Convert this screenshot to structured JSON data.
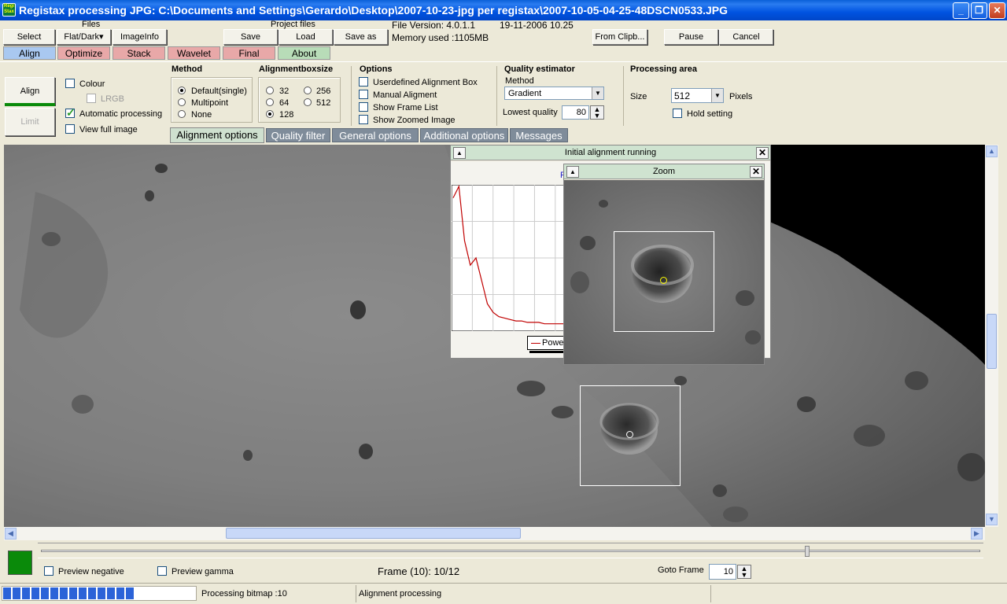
{
  "window": {
    "title": "Registax processing JPG: C:\\Documents and Settings\\Gerardo\\Desktop\\2007-10-23-jpg per registax\\2007-10-05-04-25-48DSCN0533.JPG",
    "icon_text": "Regi Stax",
    "min": "_",
    "max": "❐",
    "close": "✕"
  },
  "toolbar": {
    "files_label": "Files",
    "select": "Select",
    "flatdark": "Flat/Dark",
    "flatdark_arrow": "▾",
    "imageinfo": "ImageInfo",
    "project_label": "Project files",
    "save": "Save",
    "load": "Load",
    "saveas": "Save as",
    "file_version": "File Version: 4.0.1.1",
    "date": "19-11-2006 10.25",
    "memory": "Memory used :1105MB",
    "from_clip": "From Clipb...",
    "pause": "Pause",
    "cancel": "Cancel"
  },
  "tabs": [
    {
      "label": "Align",
      "color": "#a9c8f0"
    },
    {
      "label": "Optimize",
      "color": "#e8a8a8"
    },
    {
      "label": "Stack",
      "color": "#e8a8a8"
    },
    {
      "label": "Wavelet",
      "color": "#e8a8a8"
    },
    {
      "label": "Final",
      "color": "#e8a8a8"
    },
    {
      "label": "About",
      "color": "#b8dcb8"
    }
  ],
  "align_panel": {
    "align_btn": "Align",
    "limit_btn": "Limit",
    "colour": "Colour",
    "lrgb": "LRGB",
    "auto": "Automatic processing",
    "view_full": "View full image",
    "method_title": "Method",
    "methods": [
      "Default(single)",
      "Multipoint",
      "None"
    ],
    "boxsize_title": "Alignmentboxsize",
    "boxsizes": [
      "32",
      "256",
      "64",
      "512",
      "128"
    ],
    "options_title": "Options",
    "options": [
      "Userdefined Alignment Box",
      "Manual Aligment",
      "Show Frame List",
      "Show Zoomed Image"
    ],
    "quality_title": "Quality estimator",
    "quality_method_label": "Method",
    "quality_method_value": "Gradient",
    "lowest_quality_label": "Lowest quality",
    "lowest_quality_value": "80",
    "area_title": "Processing area",
    "size_label": "Size",
    "size_value": "512",
    "pixels": "Pixels",
    "hold": "Hold setting"
  },
  "subtabs": [
    "Alignment  options",
    "Quality  filter",
    "General options",
    "Additional options",
    "Messages"
  ],
  "init_window": {
    "title": "Initial alignment running",
    "legend": "Power",
    "f_text": "F"
  },
  "zoom_window": {
    "title": "Zoom"
  },
  "bottom": {
    "preview_negative": "Preview negative",
    "preview_gamma": "Preview gamma",
    "frame": "Frame (10): 10/12",
    "goto_label": "Goto Frame",
    "goto_value": "10"
  },
  "status": {
    "bitmap": "Processing bitmap :10",
    "processing": "Alignment processing",
    "progress": 0.7
  },
  "chart_data": {
    "type": "line",
    "x": [
      0,
      1,
      2,
      3,
      4,
      5,
      6,
      7,
      8,
      9,
      10,
      11,
      12,
      13,
      14,
      15,
      16,
      17,
      18,
      19,
      20
    ],
    "series": [
      {
        "name": "Power",
        "values": [
          92,
          100,
          62,
          45,
          50,
          34,
          18,
          12,
          9,
          8,
          7,
          6,
          6,
          5,
          5,
          5,
          4,
          4,
          4,
          4,
          4
        ]
      }
    ],
    "grid": true,
    "legend": "bottom",
    "ylim": [
      0,
      100
    ]
  },
  "colors": {
    "title_bar": "#0053e1",
    "green_indicator": "#0a8a0a",
    "progress": "#2b63d8"
  }
}
